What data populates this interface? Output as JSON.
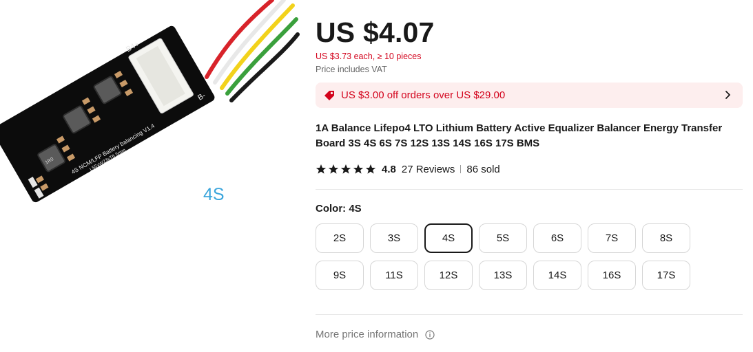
{
  "image": {
    "overlay_label": "4S",
    "pcb_texts": {
      "top_right": "B4+",
      "bottom_right": "B-",
      "model_line": "4S NCM/LFP Battery balancing V1.4",
      "size_line": "L55xW23xT6.5mm",
      "inductor_label": "1R0"
    }
  },
  "product": {
    "price": "US $4.07",
    "bulk_price": "US $3.73 each, ≥ 10 pieces",
    "vat_note": "Price includes VAT",
    "coupon": {
      "text": "US $3.00 off orders over US $29.00",
      "icon": "price-tag-icon",
      "chevron": "chevron-right-icon"
    },
    "title": "1A Balance Lifepo4 LTO Lithium Battery Active Equalizer Balancer Energy Transfer Board 3S 4S 6S 7S 12S 13S 14S 16S 17S BMS",
    "rating": {
      "stars": 5,
      "score": "4.8",
      "reviews": "27 Reviews",
      "sold": "86 sold"
    },
    "color": {
      "label": "Color:",
      "selected": "4S",
      "options": [
        "2S",
        "3S",
        "4S",
        "5S",
        "6S",
        "7S",
        "8S",
        "9S",
        "11S",
        "12S",
        "13S",
        "14S",
        "16S",
        "17S"
      ]
    },
    "more_price_info": "More price information"
  },
  "colors": {
    "price_red": "#d3031c",
    "coupon_bg": "#fdeeee",
    "text": "#191919",
    "muted": "#767676",
    "overlay_blue": "#3aa5dc"
  }
}
